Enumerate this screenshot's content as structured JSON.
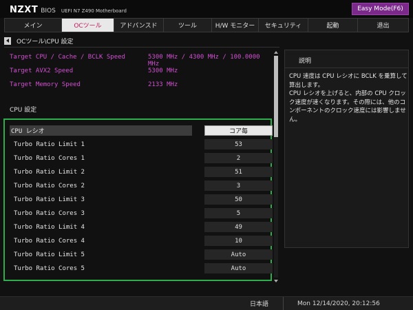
{
  "header": {
    "brand": "NZXT",
    "bios_label": "BIOS",
    "model": "UEFI  N7 Z490 Motherboard",
    "easy_mode_button": "Easy Mode(F6)",
    "accent_color": "#7b2a8c"
  },
  "nav": {
    "tabs": [
      {
        "label": "メイン",
        "active": false
      },
      {
        "label": "OCツール",
        "active": true
      },
      {
        "label": "アドバンスド",
        "active": false
      },
      {
        "label": "ツール",
        "active": false
      },
      {
        "label": "H/W モニター",
        "active": false
      },
      {
        "label": "セキュリティ",
        "active": false
      },
      {
        "label": "起動",
        "active": false
      },
      {
        "label": "退出",
        "active": false
      }
    ]
  },
  "breadcrumb": {
    "back_icon": "back-arrow-icon",
    "path": "OCツール\\CPU 設定"
  },
  "info": {
    "rows": [
      {
        "label": "Target CPU / Cache / BCLK Speed",
        "value": "5300 MHz / 4300 MHz / 100.0000 MHz"
      },
      {
        "label": "Target AVX2 Speed",
        "value": "5300 MHz"
      },
      {
        "label": "Target Memory Speed",
        "value": "2133 MHz"
      }
    ],
    "color": "#d24fd2"
  },
  "section": {
    "title": "CPU 設定"
  },
  "settings": {
    "rows": [
      {
        "label": "CPU  レシオ",
        "value": "コア毎",
        "selected": true
      },
      {
        "label": "Turbo Ratio Limit 1",
        "value": "53",
        "selected": false
      },
      {
        "label": "Turbo Ratio Cores 1",
        "value": "2",
        "selected": false
      },
      {
        "label": "Turbo Ratio Limit 2",
        "value": "51",
        "selected": false
      },
      {
        "label": "Turbo Ratio Cores 2",
        "value": "3",
        "selected": false
      },
      {
        "label": "Turbo Ratio Limit 3",
        "value": "50",
        "selected": false
      },
      {
        "label": "Turbo Ratio Cores 3",
        "value": "5",
        "selected": false
      },
      {
        "label": "Turbo Ratio Limit 4",
        "value": "49",
        "selected": false
      },
      {
        "label": "Turbo Ratio Cores 4",
        "value": "10",
        "selected": false
      },
      {
        "label": "Turbo Ratio Limit 5",
        "value": "Auto",
        "selected": false
      },
      {
        "label": "Turbo Ratio Cores 5",
        "value": "Auto",
        "selected": false
      }
    ],
    "highlight_color": "#2fae4e"
  },
  "help": {
    "title": "説明",
    "text": "CPU 速度は CPU レシオに BCLK を乗算して算出します。\nCPU レシオを上げると、内部の CPU クロック速度が速くなります。その際には、他のコンポーネントのクロック速度には影響しません。"
  },
  "status": {
    "language": "日本語",
    "datetime": "Mon 12/14/2020, 20:12:56"
  }
}
